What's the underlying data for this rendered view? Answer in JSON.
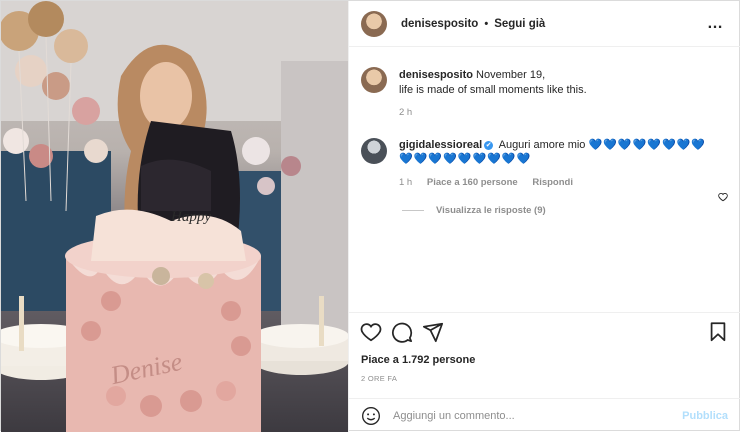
{
  "post": {
    "username": "denisesposito",
    "separator": "•",
    "follow_label": "Segui già",
    "more_icon": "…"
  },
  "caption": {
    "username": "denisesposito",
    "date": "November 19,",
    "text": "life is made of small moments like this.",
    "age": "2 h"
  },
  "comment": {
    "username": "gigidalessioreal",
    "verified_icon": "✔",
    "text": "Auguri amore mio",
    "hearts_line1": "💙💙💙💙💙💙💙💙",
    "hearts_line2": "💙💙💙💙💙💙💙💙💙",
    "age": "1 h",
    "likes": "Piace a 160 persone",
    "reply_label": "Rispondi",
    "view_replies": "Visualizza le risposte (9)"
  },
  "actions": {
    "likes_text": "Piace a 1.792 persone",
    "time_text": "2 ORE FA"
  },
  "composer": {
    "placeholder": "Aggiungi un commento...",
    "publish_label": "Pubblica"
  },
  "photo": {
    "cake_text": "Denise",
    "topper_text": "Happy"
  },
  "colors": {
    "accent": "#3897f0",
    "publish_disabled": "#b2dffc",
    "cake_pink": "#e8b8b0"
  }
}
